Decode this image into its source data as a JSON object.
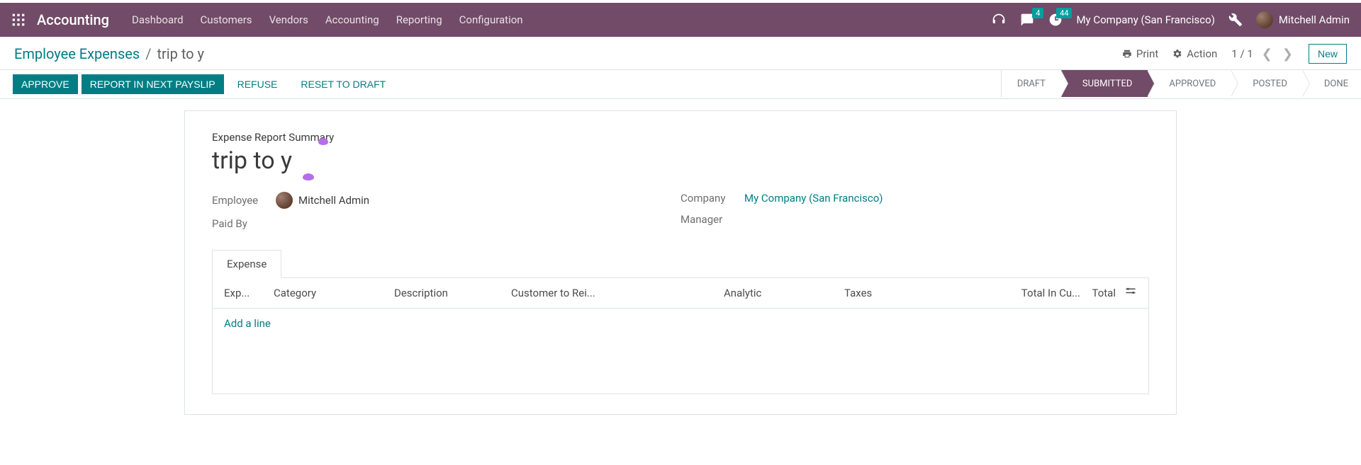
{
  "navbar": {
    "app_title": "Accounting",
    "menu": [
      "Dashboard",
      "Customers",
      "Vendors",
      "Accounting",
      "Reporting",
      "Configuration"
    ],
    "messages_badge": "4",
    "activities_badge": "44",
    "company": "My Company (San Francisco)",
    "user": "Mitchell Admin"
  },
  "breadcrumb": {
    "back": "Employee Expenses",
    "current": "trip to y"
  },
  "cp": {
    "print": "Print",
    "action": "Action",
    "pager": "1 / 1",
    "new": "New"
  },
  "status": {
    "buttons": {
      "approve": "APPROVE",
      "reportpayslip": "REPORT IN NEXT PAYSLIP",
      "refuse": "REFUSE",
      "reset": "RESET TO DRAFT"
    },
    "steps": {
      "draft": "DRAFT",
      "submitted": "SUBMITTED",
      "approved": "APPROVED",
      "posted": "POSTED",
      "done": "DONE"
    }
  },
  "form": {
    "summary_label": "Expense Report Summary",
    "title": "trip to y",
    "employee_label": "Employee",
    "employee_value": "Mitchell Admin",
    "paidby_label": "Paid By",
    "company_label": "Company",
    "company_value": "My Company (San Francisco)",
    "manager_label": "Manager"
  },
  "notebook": {
    "tab_expense": "Expense",
    "columns": {
      "expdate": "Exp...",
      "category": "Category",
      "description": "Description",
      "customer": "Customer to Rei...",
      "analytic": "Analytic",
      "taxes": "Taxes",
      "totalincur": "Total In Cu...",
      "total": "Total"
    },
    "add_line": "Add a line"
  }
}
